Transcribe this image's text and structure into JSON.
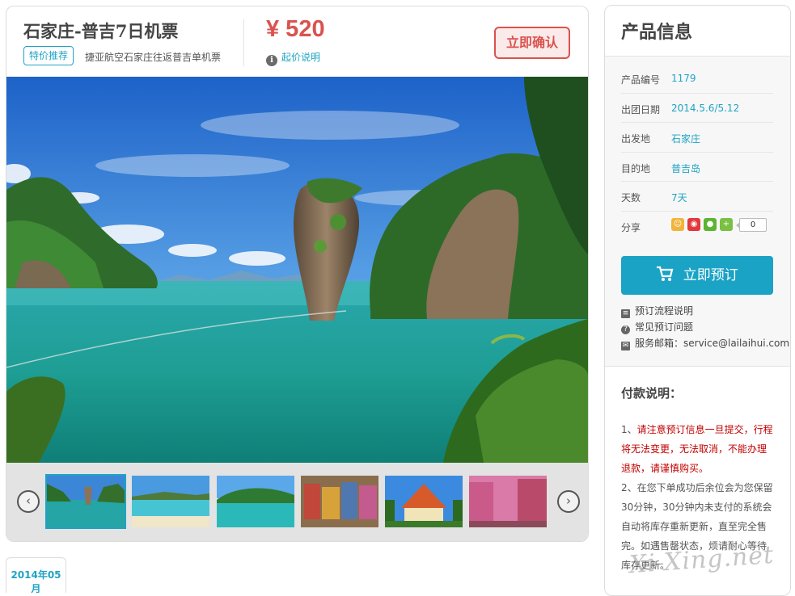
{
  "product": {
    "title": "石家庄-普吉7日机票",
    "tag": "特价推荐",
    "subtitle": "捷亚航空石家庄往返普吉单机票",
    "price": "¥ 520",
    "price_note": "起价说明",
    "price_note_icon": "info-icon",
    "confirm_label": "立即确认"
  },
  "gallery": {
    "main_image": "phang-nga-bay-khao-tapu-rock",
    "prev_icon": "chevron-left-icon",
    "next_icon": "chevron-right-icon",
    "thumbnails": [
      {
        "name": "thumb-phang-nga-bay",
        "active": true
      },
      {
        "name": "thumb-beach",
        "active": false
      },
      {
        "name": "thumb-island",
        "active": false
      },
      {
        "name": "thumb-elephants",
        "active": false
      },
      {
        "name": "thumb-temple",
        "active": false
      },
      {
        "name": "thumb-street",
        "active": false
      }
    ]
  },
  "date_tab": "2014年05月",
  "side": {
    "heading": "产品信息",
    "rows": [
      {
        "key": "产品编号",
        "value": "1179"
      },
      {
        "key": "出团日期",
        "value": "2014.5.6/5.12"
      },
      {
        "key": "出发地",
        "value": "石家庄"
      },
      {
        "key": "目的地",
        "value": "普吉岛"
      },
      {
        "key": "天数",
        "value": "7天"
      }
    ],
    "share_label": "分享",
    "share_count": "0",
    "book_label": "立即预订",
    "cart_icon": "cart-icon",
    "links": [
      {
        "icon": "document-icon",
        "label": "预订流程说明"
      },
      {
        "icon": "question-icon",
        "label": "常见预订问题"
      },
      {
        "icon": "mail-icon",
        "label": "服务邮箱：service@lailaihui.com"
      }
    ]
  },
  "payment": {
    "heading": "付款说明：",
    "item1_prefix": "1、",
    "item1": "请注意预订信息一旦提交，行程将无法变更，无法取消，不能办理退款，请谨慎购买。",
    "item2": "2、在您下单成功后余位会为您保留30分钟，30分钟内未支付的系统会自动将库存重新更新，直至完全售完。如遇售罄状态，烦请耐心等待库存更新。"
  },
  "watermark": "Xi-Xing.net",
  "colors": {
    "accent": "#1fa3c4",
    "price": "#d9534f",
    "warning_text": "#c00000"
  }
}
